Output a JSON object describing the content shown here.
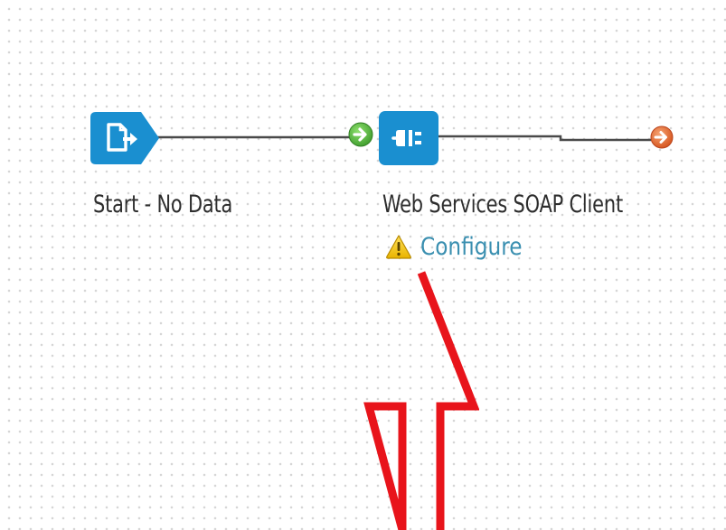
{
  "canvas": {
    "grid_color": "#d6d6d6",
    "background": "#ffffff"
  },
  "nodes": [
    {
      "id": "start",
      "label": "Start - No Data",
      "icon": "start-document-icon",
      "color": "#1a8fd0"
    },
    {
      "id": "soap",
      "label": "Web Services SOAP Client",
      "icon": "plug-icon",
      "color": "#1a8fd0",
      "status": {
        "icon": "warning-icon",
        "link_text": "Configure"
      }
    }
  ],
  "ports": {
    "input": {
      "icon": "green-arrow-icon",
      "color": "#4cae3a"
    },
    "output": {
      "icon": "orange-arrow-icon",
      "color": "#e8692a"
    }
  },
  "annotation": {
    "icon": "red-arrow-up-icon",
    "color": "#e8141b"
  }
}
